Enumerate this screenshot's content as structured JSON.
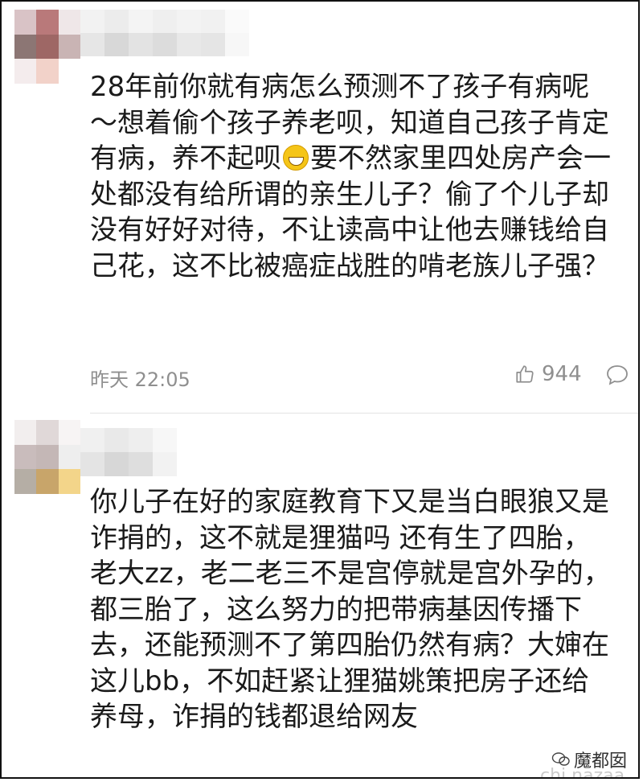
{
  "comments": [
    {
      "text_before_emoji": "28年前你就有病怎么预测不了孩子有病呢～想着偷个孩子养老呗，知道自己孩子肯定有病，养不起呗",
      "emoji": "grinning-face-icon",
      "text_after_emoji": "要不然家里四处房产会一处都没有给所谓的亲生儿子？偷了个儿子却没有好好对待，不让读高中让他去赚钱给自己花，这不比被癌症战胜的啃老族儿子强？",
      "timestamp": "昨天 22:05",
      "likes": "944"
    },
    {
      "text": "你儿子在好的家庭教育下又是当白眼狼又是诈捐的，这不就是狸猫吗 还有生了四胎，老大zz，老二老三不是宫停就是宫外孕的，都三胎了，这么努力的把带病基因传播下去，还能预测不了第四胎仍然有病？大婶在这儿bb，不如赶紧让狸猫姚策把房子还给养母，诈捐的钱都退给网友"
    }
  ],
  "watermark": {
    "label": "魔都囡",
    "sub": "chi nazaa"
  },
  "colors": {
    "text": "#1a1a1a",
    "meta": "#8f8f8f",
    "divider": "#e4e4e4"
  }
}
